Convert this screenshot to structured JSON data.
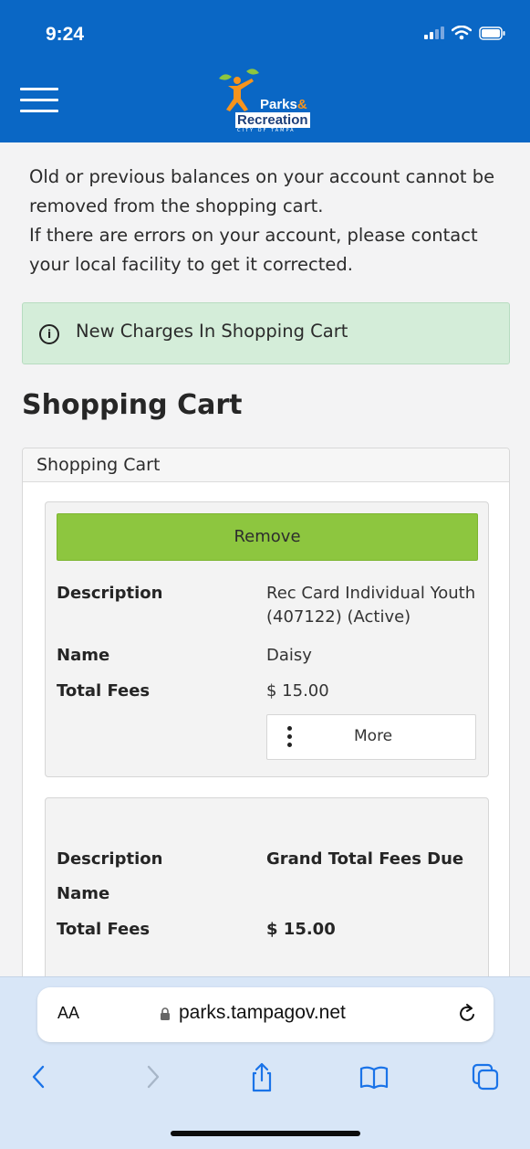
{
  "status": {
    "time": "9:24"
  },
  "header": {
    "logo_line1": "Parks",
    "logo_amp": "&",
    "logo_line2": "Recreation",
    "logo_line3": "CITY OF TAMPA"
  },
  "notice": {
    "line1": "Old or previous balances on your account cannot be removed from the shopping cart.",
    "line2": "If there are errors on your account, please contact your local facility to get it corrected."
  },
  "alert": {
    "text": "New Charges In Shopping Cart",
    "icon": "info-circle-icon"
  },
  "page_title": "Shopping Cart",
  "panel": {
    "title": "Shopping Cart"
  },
  "cart_item": {
    "remove_label": "Remove",
    "description_label": "Description",
    "description_value": "Rec Card Individual Youth (407122) (Active)",
    "name_label": "Name",
    "name_value": "Daisy",
    "fees_label": "Total Fees",
    "fees_value": "$ 15.00",
    "more_label": "More"
  },
  "summary": {
    "description_label": "Description",
    "description_value": "Grand Total Fees Due",
    "name_label": "Name",
    "fees_label": "Total Fees",
    "fees_value": "$ 15.00"
  },
  "browser": {
    "aa_label": "AA",
    "url": "parks.tampagov.net"
  },
  "colors": {
    "header_blue": "#0a67c5",
    "remove_green": "#8dc63f",
    "alert_green": "#d4edd9",
    "safari_blue": "#d8e6f7"
  }
}
